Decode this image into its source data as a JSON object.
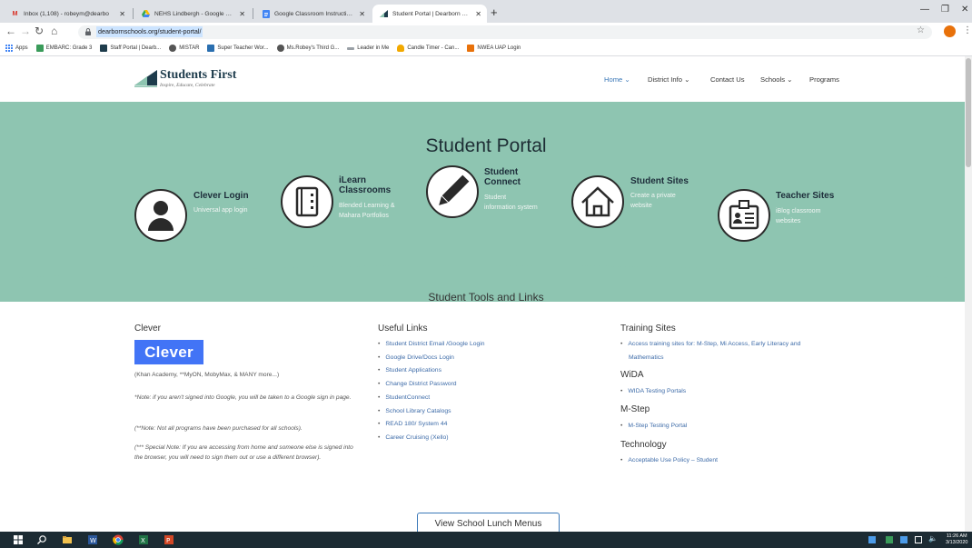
{
  "browser": {
    "tabs": [
      {
        "title": "Inbox (1,108) - robeym@dearbo",
        "icon": "gmail-icon",
        "active": false
      },
      {
        "title": "NEHS Lindbergh - Google Drive",
        "icon": "google-drive-icon",
        "active": false
      },
      {
        "title": "Google Classroom Instructions -",
        "icon": "google-docs-icon",
        "active": false
      },
      {
        "title": "Student Portal | Dearborn Public",
        "icon": "dearborn-icon",
        "active": true
      }
    ],
    "new_tab": "+",
    "url": "dearbornschools.org/student-portal/",
    "bookmarks": [
      {
        "label": "Apps",
        "icon": "apps-grid-icon",
        "color": "#4285f4"
      },
      {
        "label": "EMBARC: Grade 3",
        "icon": "embarc-icon",
        "color": "#3a9b5a"
      },
      {
        "label": "Staff Portal | Dearb...",
        "icon": "dearborn-icon",
        "color": "#1e3c4c"
      },
      {
        "label": "MISTAR",
        "icon": "web-icon",
        "color": "#555555"
      },
      {
        "label": "Super Teacher Wor...",
        "icon": "super-teacher-icon",
        "color": "#2a6fb0"
      },
      {
        "label": "Ms.Robey's Third G...",
        "icon": "web-icon",
        "color": "#555555"
      },
      {
        "label": "Leader in Me",
        "icon": "leader-in-me-icon",
        "color": "#9aa0a6"
      },
      {
        "label": "Candle Timer - Can...",
        "icon": "candle-icon",
        "color": "#f2a900"
      },
      {
        "label": "NWEA UAP Login",
        "icon": "nwea-icon",
        "color": "#e8710a"
      }
    ]
  },
  "site": {
    "logo_title": "Students First",
    "logo_tagline": "Inspire, Educate, Celebrate",
    "nav": [
      "Home",
      "District Info",
      "Contact Us",
      "Schools",
      "Programs"
    ],
    "nav_caret": "⌄",
    "hero_title": "Student Portal",
    "cards": [
      {
        "title": "Clever Login",
        "desc": [
          "Universal app login"
        ],
        "icon": "user-silhouette-icon"
      },
      {
        "title": "iLearn\nClassrooms",
        "desc": [
          "Blended Learning &",
          "Mahara Portfolios"
        ],
        "icon": "notebook-icon"
      },
      {
        "title": "Student\nConnect",
        "desc": [
          "Student",
          "information system"
        ],
        "icon": "pencil-icon"
      },
      {
        "title": "Student Sites",
        "desc": [
          "Create a private",
          "website"
        ],
        "icon": "house-icon"
      },
      {
        "title": "Teacher Sites",
        "desc": [
          "iBlog classroom",
          "websites"
        ],
        "icon": "id-badge-icon"
      }
    ],
    "tools_title": "Student Tools and Links",
    "clever": {
      "heading": "Clever",
      "logo_text": "Clever",
      "sub": "(Khan Academy, **MyON, MobyMax, & MANY more...)",
      "note1": "*Note: if you aren't signed into Google, you will be taken to a Google sign in page.",
      "note2": "(**Note: Not all programs have been purchased for all schools).",
      "note3": "(*** Special Note: If you are accessing from home and someone else is signed into the browser, you will need to sign them out or use a different browser)."
    },
    "useful": {
      "heading": "Useful Links",
      "links": [
        "Student District Email /Google Login",
        "Google Drive/Docs Login",
        "Student Applications",
        "Change District Password",
        "StudentConnect",
        "School Library Catalogs",
        "READ 180/ System 44",
        "Career Cruising (Xello)"
      ]
    },
    "training": {
      "heading": "Training Sites",
      "link1": "Access training sites for: M-Step, Mi Access, Early Literacy and",
      "link1b": "Mathematics",
      "wida_heading": "WiDA",
      "wida_link": "WIDA Testing Portals",
      "mstep_heading": "M-Step",
      "mstep_link": "M-Step Testing Portal",
      "tech_heading": "Technology",
      "tech_link": "Acceptable Use Policy – Student"
    },
    "lunch_button": "View School Lunch Menus"
  },
  "taskbar": {
    "time": "11:26 AM",
    "date": "3/13/2020"
  },
  "colors": {
    "hero": "#8ec5b1",
    "link": "#3d6ba8",
    "clever": "#4274f6",
    "taskbar": "#1c2b33"
  }
}
